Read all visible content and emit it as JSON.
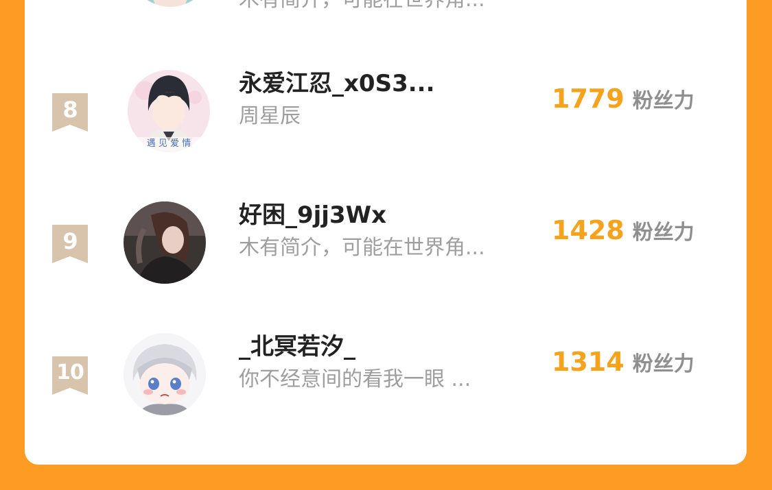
{
  "colors": {
    "background": "#FC9C22",
    "card": "#FFFFFF",
    "fans_count": "#F5A21C",
    "fans_label": "#8F8F8F",
    "name": "#222222",
    "bio": "#9E9E9E",
    "rank_badge": "#D8C4AD"
  },
  "ranking": {
    "top_partial_row": {
      "bio": "木有简介，可能在世界角..."
    },
    "rows": [
      {
        "rank": "8",
        "name": "永爱江忍_x0S3...",
        "bio": "周星辰",
        "fans_count": "1779",
        "fans_label": "粉丝力",
        "avatar_caption": "遇 见 爱 情"
      },
      {
        "rank": "9",
        "name": "好困_9jj3Wx",
        "bio": "木有简介，可能在世界角...",
        "fans_count": "1428",
        "fans_label": "粉丝力"
      },
      {
        "rank": "10",
        "name": "_北冥若汐_",
        "bio": "你不经意间的看我一眼 ...",
        "fans_count": "1314",
        "fans_label": "粉丝力"
      }
    ]
  }
}
